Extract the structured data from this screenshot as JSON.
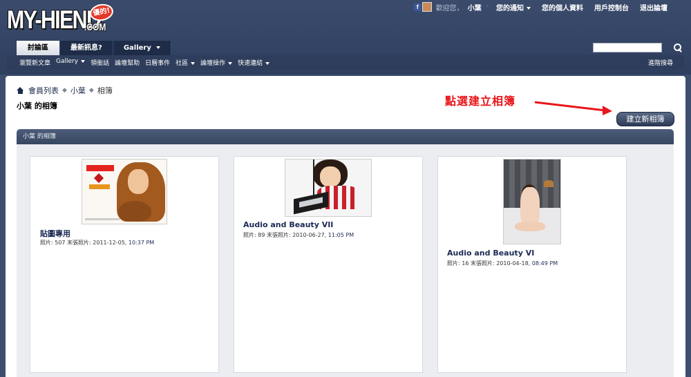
{
  "logo": {
    "main": "MY-HIEND",
    "com": ".COM",
    "badge": "優的!"
  },
  "topbar": {
    "welcome": "歡迎您，",
    "username": "小葉",
    "notifications": "您的通知",
    "profile": "您的個人資料",
    "usercp": "用戶控制台",
    "logout": "退出論壇"
  },
  "navtabs": [
    {
      "label": "討論區"
    },
    {
      "label": "最新訊息?"
    },
    {
      "label": "Gallery"
    }
  ],
  "subnav": [
    {
      "label": "瀏覽新文章"
    },
    {
      "label": "Gallery"
    },
    {
      "label": "領銜話"
    },
    {
      "label": "論壇幫助"
    },
    {
      "label": "日曆事件"
    },
    {
      "label": "社區"
    },
    {
      "label": "論壇操作"
    },
    {
      "label": "快速連結"
    }
  ],
  "advanced_search": "進階搜尋",
  "breadcrumb": {
    "members": "會員列表",
    "user": "小葉",
    "current": "相簿"
  },
  "page_title": "小葉 的相簿",
  "annotation": "點選建立相簿",
  "create_album_button": "建立新相簿",
  "section_title": "小葉 的相簿",
  "albums": [
    {
      "name": "貼圖專用",
      "meta": "照片: 507 末張照片: 2011-12-05,",
      "time": "10:37 PM"
    },
    {
      "name": "Audio and Beauty VII",
      "meta": "照片: 89 末張照片: 2010-06-27,",
      "time": "11:05 PM"
    },
    {
      "name": "Audio and Beauty VI",
      "meta": "照片: 16 末張照片: 2010-04-18,",
      "time": "08:49 PM"
    }
  ],
  "colors": {
    "header": "#3b4b6b",
    "annotation": "#e8161a",
    "link": "#1b2a55"
  }
}
